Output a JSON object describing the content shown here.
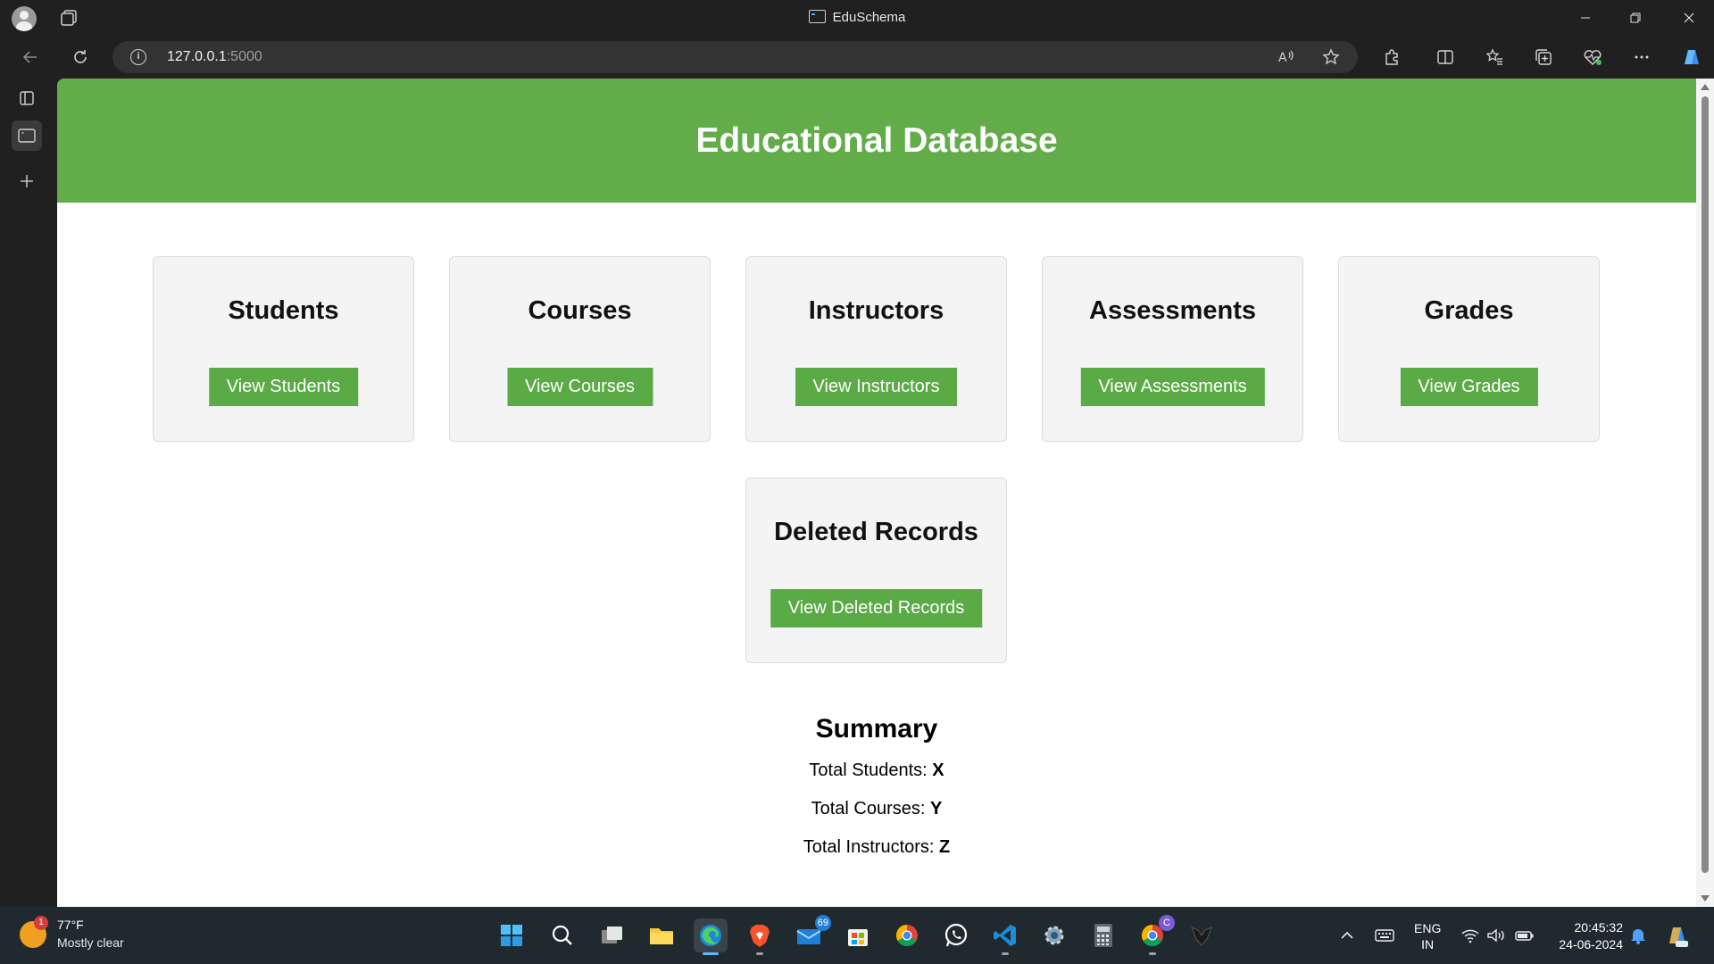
{
  "window": {
    "title": "EduSchema"
  },
  "browser": {
    "url_host": "127.0.0.1",
    "url_port": ":5000"
  },
  "page": {
    "header_title": "Educational Database",
    "cards": [
      {
        "title": "Students",
        "button": "View Students"
      },
      {
        "title": "Courses",
        "button": "View Courses"
      },
      {
        "title": "Instructors",
        "button": "View Instructors"
      },
      {
        "title": "Assessments",
        "button": "View Assessments"
      },
      {
        "title": "Grades",
        "button": "View Grades"
      },
      {
        "title": "Deleted Records",
        "button": "View Deleted Records"
      }
    ],
    "summary": {
      "title": "Summary",
      "rows": [
        {
          "label": "Total Students: ",
          "value": "X"
        },
        {
          "label": "Total Courses: ",
          "value": "Y"
        },
        {
          "label": "Total Instructors: ",
          "value": "Z"
        }
      ]
    }
  },
  "taskbar": {
    "weather_temp": "77°F",
    "weather_condition": "Mostly clear",
    "weather_badge": "1",
    "mail_badge": "69",
    "chrome_badge": "C",
    "lang_line1": "ENG",
    "lang_line2": "IN",
    "time": "20:45:32",
    "date": "24-06-2024"
  },
  "colors": {
    "header_green": "#62ad4a",
    "button_green": "#5aaa46",
    "card_bg": "#f4f4f4"
  }
}
